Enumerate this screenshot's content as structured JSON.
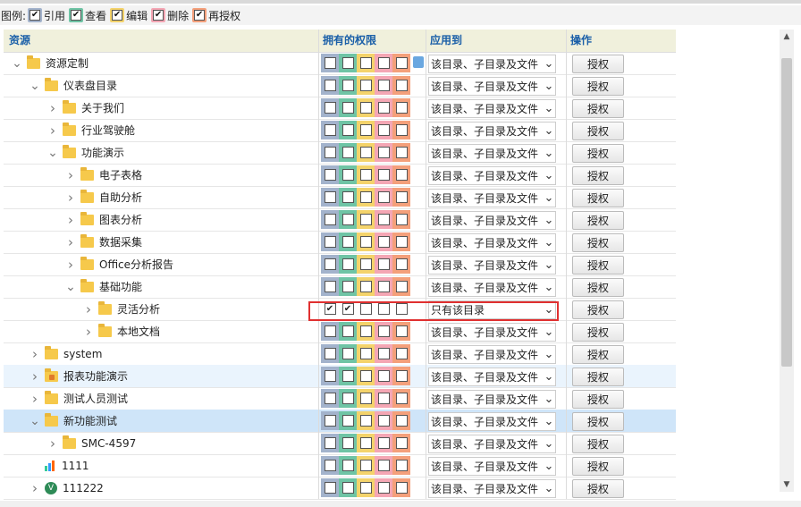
{
  "legend": {
    "prefix": "图例:",
    "items": [
      {
        "label": "引用",
        "color": "#a3b3cc"
      },
      {
        "label": "查看",
        "color": "#6fc4a5"
      },
      {
        "label": "编辑",
        "color": "#f4d36b"
      },
      {
        "label": "删除",
        "color": "#f4a6b4"
      },
      {
        "label": "再授权",
        "color": "#f4a07b"
      }
    ],
    "check_mark": "✔"
  },
  "header": {
    "resource": "资源",
    "permissions": "拥有的权限",
    "apply_to": "应用到",
    "action": "操作"
  },
  "grant_label": "授权",
  "rows": [
    {
      "label": "资源定制",
      "expand": "v",
      "icon": "folder-icon",
      "apply": "该目录、子目录及文件"
    },
    {
      "label": "仪表盘目录",
      "expand": "v",
      "icon": "folder-icon",
      "apply": "该目录、子目录及文件"
    },
    {
      "label": "关于我们",
      "expand": ">",
      "icon": "folder-icon",
      "apply": "该目录、子目录及文件"
    },
    {
      "label": "行业驾驶舱",
      "expand": ">",
      "icon": "folder-icon",
      "apply": "该目录、子目录及文件"
    },
    {
      "label": "功能演示",
      "expand": "v",
      "icon": "folder-icon",
      "apply": "该目录、子目录及文件"
    },
    {
      "label": "电子表格",
      "expand": ">",
      "icon": "folder-icon",
      "apply": "该目录、子目录及文件"
    },
    {
      "label": "自助分析",
      "expand": ">",
      "icon": "folder-icon",
      "apply": "该目录、子目录及文件"
    },
    {
      "label": "图表分析",
      "expand": ">",
      "icon": "folder-icon",
      "apply": "该目录、子目录及文件"
    },
    {
      "label": "数据采集",
      "expand": ">",
      "icon": "folder-icon",
      "apply": "该目录、子目录及文件"
    },
    {
      "label": "Office分析报告",
      "expand": ">",
      "icon": "folder-icon",
      "apply": "该目录、子目录及文件"
    },
    {
      "label": "基础功能",
      "expand": "v",
      "icon": "folder-icon",
      "apply": "该目录、子目录及文件"
    },
    {
      "label": "灵活分析",
      "expand": ">",
      "icon": "folder-icon",
      "apply": "只有该目录"
    },
    {
      "label": "本地文档",
      "expand": ">",
      "icon": "folder-icon",
      "apply": "该目录、子目录及文件"
    },
    {
      "label": "system",
      "expand": ">",
      "icon": "folder-icon",
      "apply": "该目录、子目录及文件"
    },
    {
      "label": "报表功能演示",
      "expand": ">",
      "icon": "folder-lock-icon",
      "apply": "该目录、子目录及文件"
    },
    {
      "label": "测试人员测试",
      "expand": ">",
      "icon": "folder-icon",
      "apply": "该目录、子目录及文件"
    },
    {
      "label": "新功能测试",
      "expand": "v",
      "icon": "folder-icon",
      "apply": "该目录、子目录及文件"
    },
    {
      "label": "SMC-4597",
      "expand": ">",
      "icon": "folder-icon",
      "apply": "该目录、子目录及文件"
    },
    {
      "label": "1111",
      "expand": "",
      "icon": "chart-icon",
      "apply": "该目录、子目录及文件"
    },
    {
      "label": "111222",
      "expand": ">",
      "icon": "v-icon",
      "apply": "该目录、子目录及文件"
    }
  ]
}
